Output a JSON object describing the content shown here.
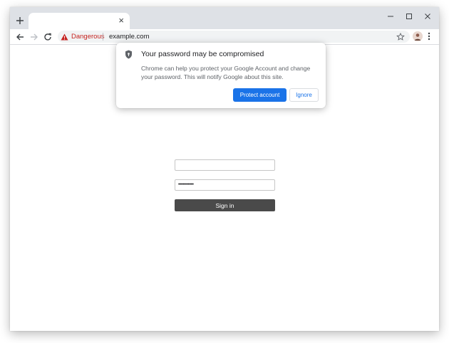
{
  "tabstrip": {
    "tab_close_glyph": "×",
    "new_tab_icon": "plus-icon",
    "window_controls": [
      "minimize-icon",
      "maximize-icon",
      "close-icon"
    ]
  },
  "toolbar": {
    "nav_icons": [
      "back-arrow-icon",
      "forward-arrow-icon",
      "reload-icon"
    ],
    "security_label": "Dangerous",
    "url": "example.com",
    "danger_color": "#c5221f"
  },
  "bubble": {
    "title": "Your password may be compromised",
    "body": "Chrome can help you protect your Google Account and change your password. This will notify Google about this site.",
    "primary_label": "Protect account",
    "secondary_label": "Ignore",
    "accent_color": "#1a73e8"
  },
  "form": {
    "username_value": "",
    "password_value": "•••••••••••",
    "signin_label": "Sign in"
  }
}
